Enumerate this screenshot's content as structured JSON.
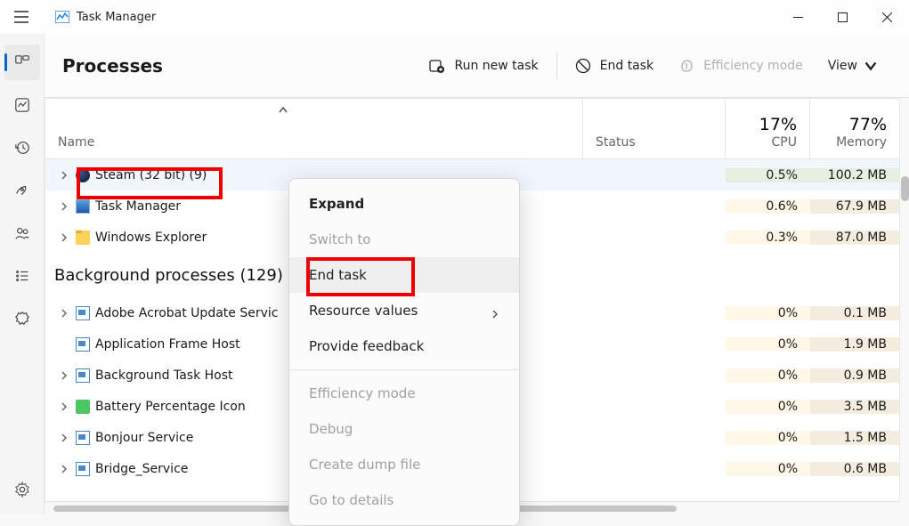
{
  "titlebar": {
    "app_name": "Task Manager"
  },
  "header": {
    "page_title": "Processes",
    "run_new_task": "Run new task",
    "end_task": "End task",
    "efficiency_mode": "Efficiency mode",
    "view": "View"
  },
  "columns": {
    "name": "Name",
    "status": "Status",
    "cpu_pct": "17%",
    "cpu": "CPU",
    "mem_pct": "77%",
    "mem": "Memory"
  },
  "background_group": "Background processes (129)",
  "processes": [
    {
      "name": "Steam (32 bit) (9)",
      "cpu": "0.5%",
      "mem": "100.2 MB",
      "icon": "steam",
      "sel": true,
      "expand": true
    },
    {
      "name": "Task Manager",
      "cpu": "0.6%",
      "mem": "67.9 MB",
      "icon": "tm",
      "sel": false,
      "expand": true
    },
    {
      "name": "Windows Explorer",
      "cpu": "0.3%",
      "mem": "87.0 MB",
      "icon": "explorer",
      "sel": false,
      "expand": true
    }
  ],
  "background": [
    {
      "name": "Adobe Acrobat Update Servic",
      "cpu": "0%",
      "mem": "0.1 MB",
      "icon": "generic",
      "expand": true
    },
    {
      "name": "Application Frame Host",
      "cpu": "0%",
      "mem": "1.9 MB",
      "icon": "generic",
      "expand": false
    },
    {
      "name": "Background Task Host",
      "cpu": "0%",
      "mem": "0.9 MB",
      "icon": "generic",
      "expand": true
    },
    {
      "name": "Battery Percentage Icon",
      "cpu": "0%",
      "mem": "3.5 MB",
      "icon": "battery",
      "expand": true
    },
    {
      "name": "Bonjour Service",
      "cpu": "0%",
      "mem": "1.5 MB",
      "icon": "generic",
      "expand": true
    },
    {
      "name": "Bridge_Service",
      "cpu": "0%",
      "mem": "0.6 MB",
      "icon": "generic",
      "expand": true
    }
  ],
  "context_menu": {
    "expand": "Expand",
    "switch_to": "Switch to",
    "end_task": "End task",
    "resource_values": "Resource values",
    "provide_feedback": "Provide feedback",
    "efficiency_mode": "Efficiency mode",
    "debug": "Debug",
    "create_dump": "Create dump file",
    "go_to_details": "Go to details"
  }
}
